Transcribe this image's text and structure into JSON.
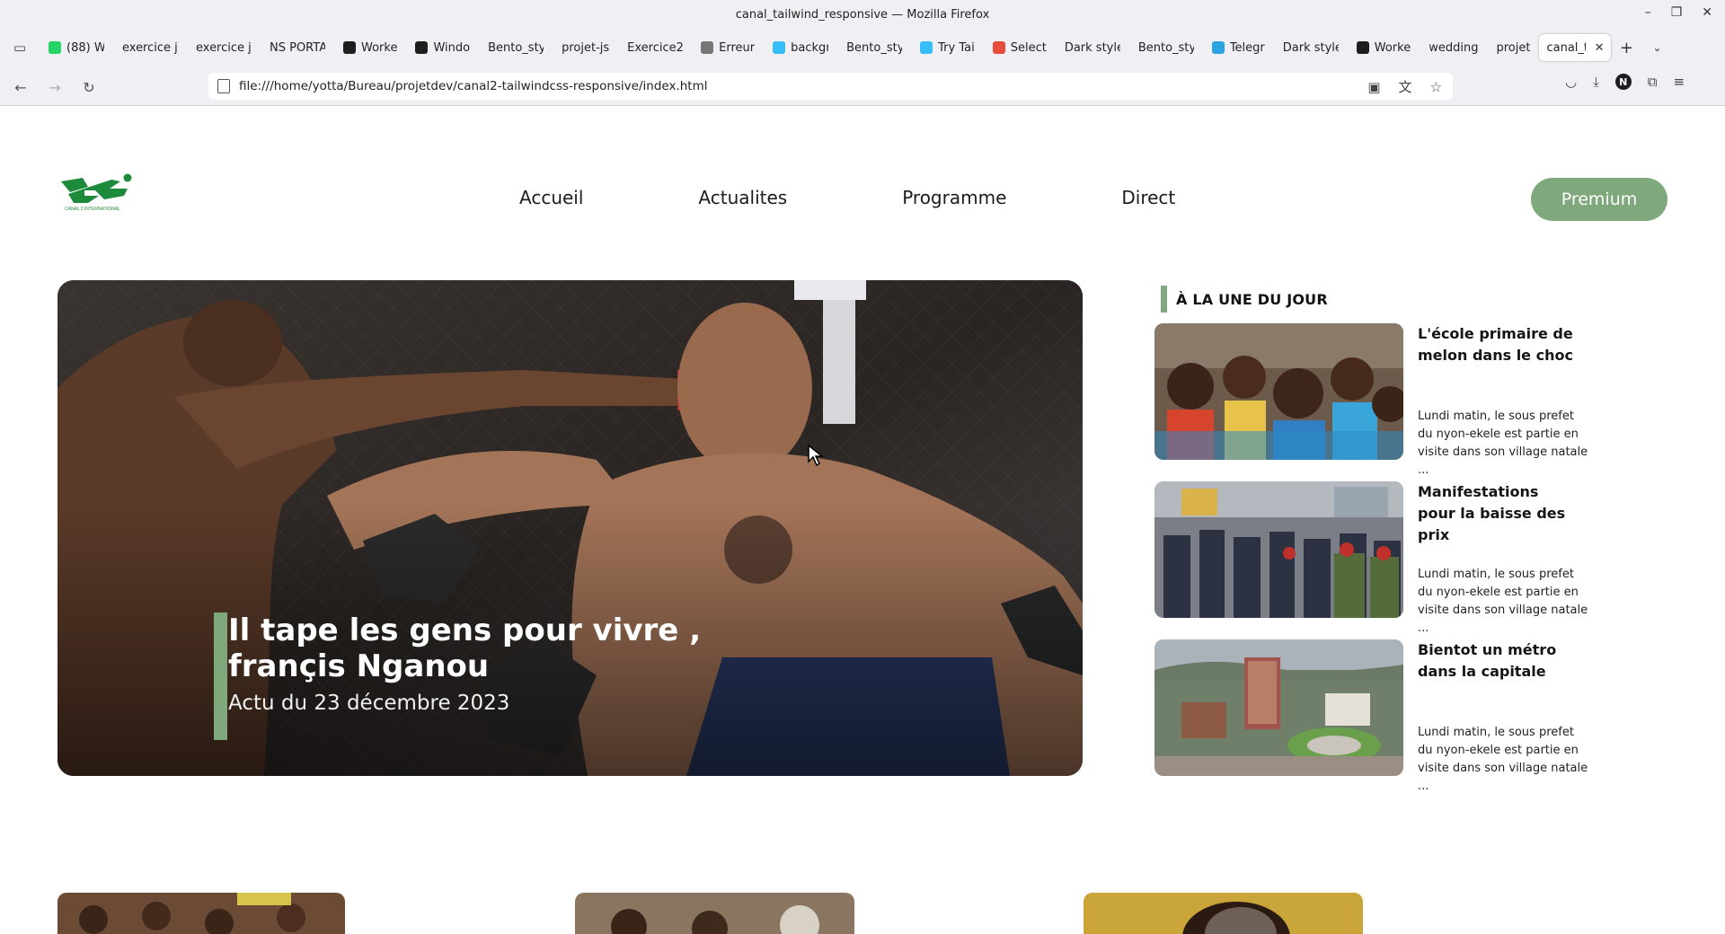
{
  "window": {
    "title": "canal_tailwind_responsive — Mozilla Firefox"
  },
  "tabs": [
    {
      "label": "(88) W",
      "favicon_color": "#25d366"
    },
    {
      "label": "exercice js",
      "favicon_color": ""
    },
    {
      "label": "exercice js",
      "favicon_color": ""
    },
    {
      "label": "NS PORTA",
      "favicon_color": ""
    },
    {
      "label": "Worke",
      "favicon_color": "#1e1e1e"
    },
    {
      "label": "Windo",
      "favicon_color": "#1e1e1e"
    },
    {
      "label": "Bento_sty",
      "favicon_color": ""
    },
    {
      "label": "projet-js",
      "favicon_color": ""
    },
    {
      "label": "Exercice2",
      "favicon_color": ""
    },
    {
      "label": "Erreur",
      "favicon_color": "#777777"
    },
    {
      "label": "backgr",
      "favicon_color": "#38bdf8"
    },
    {
      "label": "Bento_sty",
      "favicon_color": ""
    },
    {
      "label": "Try Tai",
      "favicon_color": "#38bdf8"
    },
    {
      "label": "Select",
      "favicon_color": "#e94e3c"
    },
    {
      "label": "Dark style",
      "favicon_color": ""
    },
    {
      "label": "Bento_sty",
      "favicon_color": ""
    },
    {
      "label": "Telegr",
      "favicon_color": "#2aa3e0"
    },
    {
      "label": "Dark style",
      "favicon_color": ""
    },
    {
      "label": "Worke",
      "favicon_color": "#1e1e1e"
    },
    {
      "label": "wedding",
      "favicon_color": ""
    },
    {
      "label": "projet",
      "favicon_color": ""
    }
  ],
  "active_tab": {
    "label": "canal_t"
  },
  "address": {
    "url": "file:///home/yotta/Bureau/projetdev/canal2-tailwindcss-responsive/index.html"
  },
  "toolbar": {
    "account_initial": "N"
  },
  "site": {
    "logo_text": "CANAL 2 INTERNATIONAL",
    "nav": [
      {
        "label": "Accueil"
      },
      {
        "label": "Actualites"
      },
      {
        "label": "Programme"
      },
      {
        "label": "Direct"
      }
    ],
    "premium_label": "Premium",
    "accent_color": "#7fa97c"
  },
  "hero": {
    "title": "Il tape les gens pour vivre , françis Nganou",
    "date": "Actu du 23 décembre 2023"
  },
  "une": {
    "heading": "À LA UNE DU JOUR",
    "cards": [
      {
        "title": "L'école primaire de melon dans le choc",
        "desc": "Lundi matin, le sous prefet du nyon-ekele est partie en visite dans son village natale ..."
      },
      {
        "title": "Manifestations pour la baisse des prix",
        "desc": "Lundi matin, le sous prefet du nyon-ekele est partie en visite dans son village natale ..."
      },
      {
        "title": "Bientot un métro dans la capitale",
        "desc": "Lundi matin, le sous prefet du nyon-ekele est partie en visite dans son village natale ..."
      }
    ]
  }
}
